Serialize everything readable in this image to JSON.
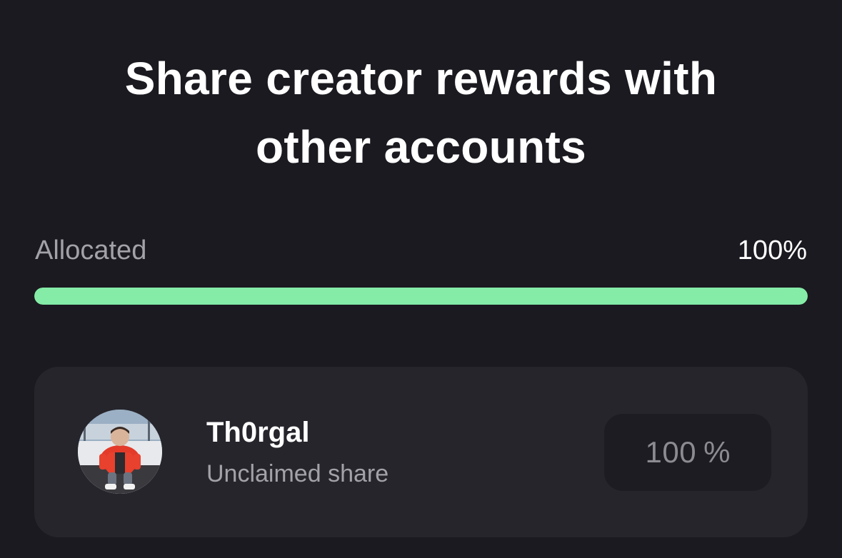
{
  "header": {
    "title_line1": "Share creator rewards with",
    "title_line2": "other accounts"
  },
  "allocation": {
    "label": "Allocated",
    "value_text": "100%",
    "progress_fraction": 1.0,
    "colors": {
      "fill": "#84eca6",
      "track": "#3a3940"
    }
  },
  "accounts": [
    {
      "name": "Th0rgal",
      "status": "Unclaimed share",
      "share_value": "100",
      "share_unit": "%",
      "avatar_icon": "user-avatar-photo"
    }
  ],
  "theme": {
    "background": "#1b1a20",
    "card": "#26252c",
    "input": "#1d1c22",
    "accent": "#84eca6"
  }
}
